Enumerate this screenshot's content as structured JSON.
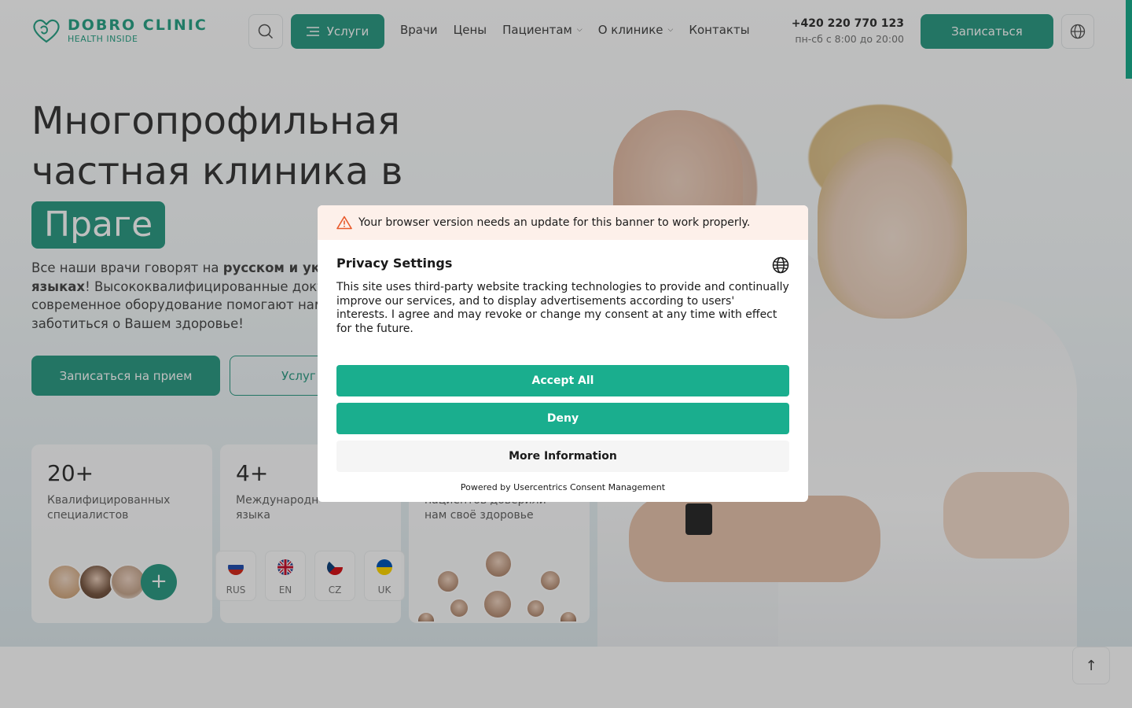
{
  "header": {
    "logo_title": "DOBRO CLINIC",
    "logo_subtitle": "HEALTH INSIDE",
    "services_label": "Услуги",
    "nav": [
      {
        "label": "Врачи",
        "has_dropdown": false
      },
      {
        "label": "Цены",
        "has_dropdown": false
      },
      {
        "label": "Пациентам",
        "has_dropdown": true
      },
      {
        "label": "О клинике",
        "has_dropdown": true
      },
      {
        "label": "Контакты",
        "has_dropdown": false
      }
    ],
    "phone": "+420 220 770 123",
    "hours": "пн-сб с 8:00 до 20:00",
    "book_label": "Записаться"
  },
  "hero": {
    "title_line1": "Многопрофильная",
    "title_line2": "частная клиника в",
    "title_highlight": "Праге",
    "desc_1": "Все наши врачи говорят на ",
    "desc_bold_1": "русском и укр",
    "desc_bold_2": "языках",
    "desc_2": "! Высококвалифицированные докто",
    "desc_3": "современное оборудование помогают нам",
    "desc_4": "заботиться о Вашем здоровье!",
    "cta_primary": "Записаться на прием",
    "cta_secondary": "Услуг"
  },
  "stats": [
    {
      "number": "20+",
      "label_1": "Квалифицированных",
      "label_2": "специалистов"
    },
    {
      "number": "4+",
      "label_1": "Международн",
      "label_2": "языка"
    },
    {
      "number": "",
      "label_1": "пациентов доверили",
      "label_2": "нам своё здоровье"
    }
  ],
  "languages": [
    {
      "code": "RUS"
    },
    {
      "code": "EN"
    },
    {
      "code": "CZ"
    },
    {
      "code": "UK"
    }
  ],
  "consent": {
    "warning": "Your browser version needs an update for this banner to work properly.",
    "title": "Privacy Settings",
    "text": "This site uses third-party website tracking technologies to provide and continually improve our services, and to display advertisements according to users' interests. I agree and may revoke or change my consent at any time with effect for the future.",
    "accept_label": "Accept All",
    "deny_label": "Deny",
    "more_label": "More Information",
    "footer": "Powered by Usercentrics Consent Management"
  },
  "colors": {
    "brand": "#2f9d86",
    "consent_accent": "#1aae8e",
    "warning_bg": "#fdf0ea"
  }
}
